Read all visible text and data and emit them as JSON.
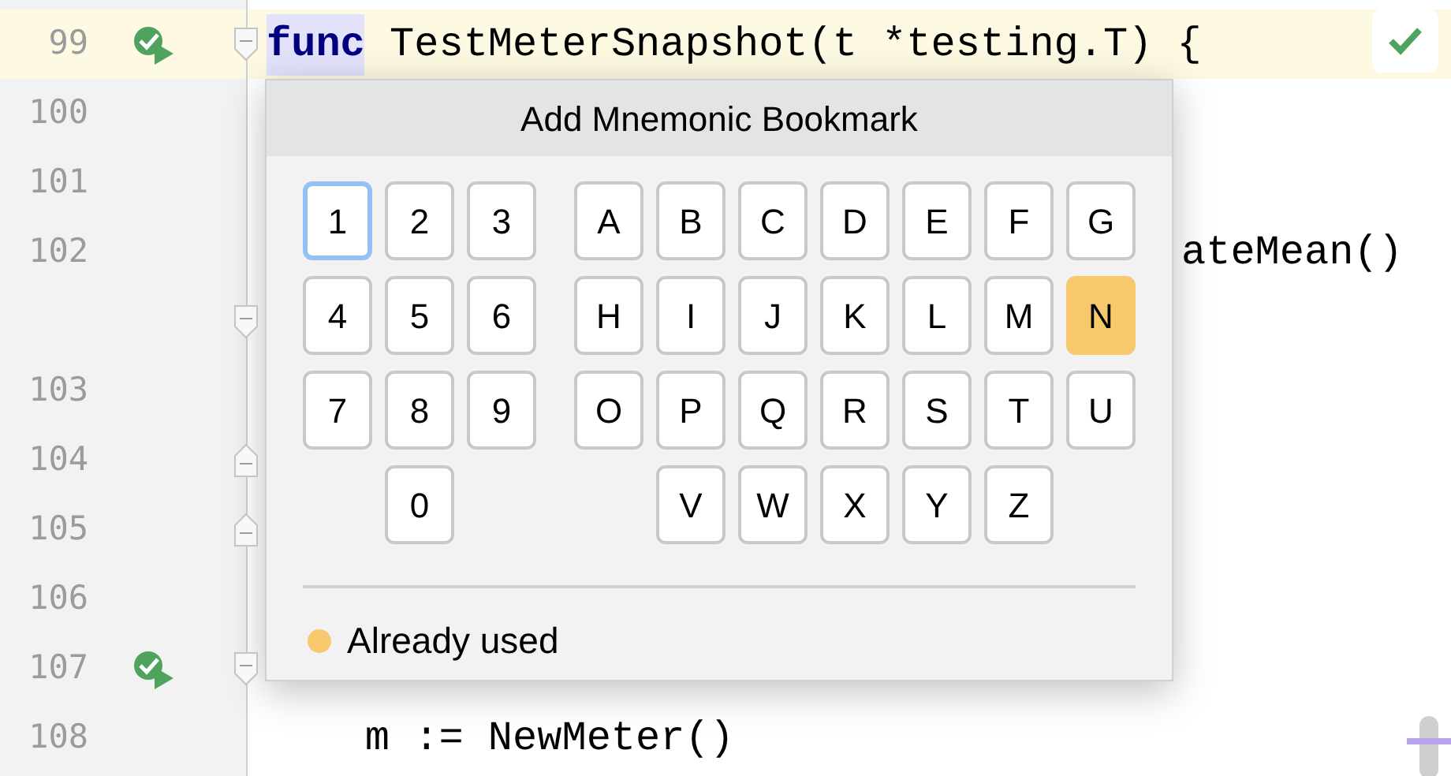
{
  "editor": {
    "lines": [
      {
        "number": "99",
        "current": true,
        "run_icon": true,
        "fold": {
          "kind": "start"
        },
        "segments": [
          {
            "text": "func",
            "kind": "keyword"
          },
          {
            "text": " TestMeterSnapshot(t *testing.T) {",
            "kind": "plain"
          }
        ]
      },
      {
        "number": "100"
      },
      {
        "number": "101"
      },
      {
        "number": "102",
        "segments": [
          {
            "text": "ateMean()",
            "kind": "clipped"
          }
        ]
      },
      {
        "fold": {
          "kind": "start"
        }
      },
      {
        "number": "103"
      },
      {
        "number": "104",
        "fold": {
          "kind": "end"
        }
      },
      {
        "number": "105",
        "fold": {
          "kind": "end"
        }
      },
      {
        "number": "106"
      },
      {
        "number": "107",
        "run_icon": true,
        "fold": {
          "kind": "start"
        }
      },
      {
        "number": "108",
        "segments": [
          {
            "text": "    m := NewMeter()",
            "kind": "plain"
          }
        ]
      }
    ]
  },
  "popup": {
    "title": "Add Mnemonic Bookmark",
    "digits": [
      {
        "label": "1",
        "focused": true,
        "used": false
      },
      {
        "label": "2",
        "focused": false,
        "used": false
      },
      {
        "label": "3",
        "focused": false,
        "used": false
      },
      {
        "label": "4",
        "focused": false,
        "used": false
      },
      {
        "label": "5",
        "focused": false,
        "used": false
      },
      {
        "label": "6",
        "focused": false,
        "used": false
      },
      {
        "label": "7",
        "focused": false,
        "used": false
      },
      {
        "label": "8",
        "focused": false,
        "used": false
      },
      {
        "label": "9",
        "focused": false,
        "used": false
      },
      {
        "label": "0",
        "focused": false,
        "used": false
      }
    ],
    "letters": [
      {
        "label": "A",
        "focused": false,
        "used": false
      },
      {
        "label": "B",
        "focused": false,
        "used": false
      },
      {
        "label": "C",
        "focused": false,
        "used": false
      },
      {
        "label": "D",
        "focused": false,
        "used": false
      },
      {
        "label": "E",
        "focused": false,
        "used": false
      },
      {
        "label": "F",
        "focused": false,
        "used": false
      },
      {
        "label": "G",
        "focused": false,
        "used": false
      },
      {
        "label": "H",
        "focused": false,
        "used": false
      },
      {
        "label": "I",
        "focused": false,
        "used": false
      },
      {
        "label": "J",
        "focused": false,
        "used": false
      },
      {
        "label": "K",
        "focused": false,
        "used": false
      },
      {
        "label": "L",
        "focused": false,
        "used": false
      },
      {
        "label": "M",
        "focused": false,
        "used": false
      },
      {
        "label": "N",
        "focused": false,
        "used": true
      },
      {
        "label": "O",
        "focused": false,
        "used": false
      },
      {
        "label": "P",
        "focused": false,
        "used": false
      },
      {
        "label": "Q",
        "focused": false,
        "used": false
      },
      {
        "label": "R",
        "focused": false,
        "used": false
      },
      {
        "label": "S",
        "focused": false,
        "used": false
      },
      {
        "label": "T",
        "focused": false,
        "used": false
      },
      {
        "label": "U",
        "focused": false,
        "used": false
      },
      {
        "label": "V",
        "focused": false,
        "used": false
      },
      {
        "label": "W",
        "focused": false,
        "used": false
      },
      {
        "label": "X",
        "focused": false,
        "used": false
      },
      {
        "label": "Y",
        "focused": false,
        "used": false
      },
      {
        "label": "Z",
        "focused": false,
        "used": false
      }
    ],
    "legend": {
      "label": "Already used",
      "color": "#f7c86c"
    }
  }
}
